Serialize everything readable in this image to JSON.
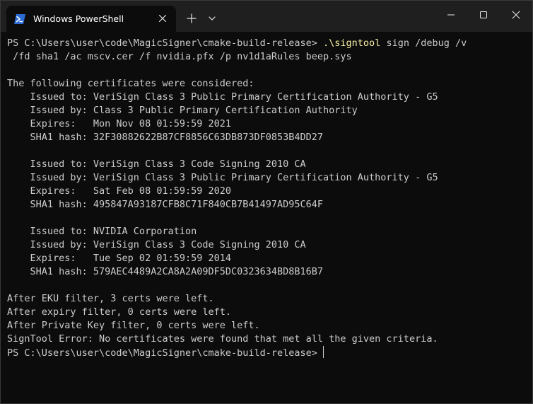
{
  "window": {
    "tab_title": "Windows PowerShell",
    "new_tab_symbol": "+"
  },
  "terminal": {
    "prompt": "PS C:\\Users\\user\\code\\MagicSigner\\cmake-build-release> ",
    "command": ".\\signtool",
    "command_args": " sign /debug /v",
    "command_continuation": " /fd sha1 /ac mscv.cer /f nvidia.pfx /p nv1d1aRules beep.sys",
    "lines": [
      "",
      "The following certificates were considered:",
      "    Issued to: VeriSign Class 3 Public Primary Certification Authority - G5",
      "    Issued by: Class 3 Public Primary Certification Authority",
      "    Expires:   Mon Nov 08 01:59:59 2021",
      "    SHA1 hash: 32F30882622B87CF8856C63DB873DF0853B4DD27",
      "",
      "    Issued to: VeriSign Class 3 Code Signing 2010 CA",
      "    Issued by: VeriSign Class 3 Public Primary Certification Authority - G5",
      "    Expires:   Sat Feb 08 01:59:59 2020",
      "    SHA1 hash: 495847A93187CFB8C71F840CB7B41497AD95C64F",
      "",
      "    Issued to: NVIDIA Corporation",
      "    Issued by: VeriSign Class 3 Code Signing 2010 CA",
      "    Expires:   Tue Sep 02 01:59:59 2014",
      "    SHA1 hash: 579AEC4489A2CA8A2A09DF5DC0323634BD8B16B7",
      "",
      "After EKU filter, 3 certs were left.",
      "After expiry filter, 0 certs were left.",
      "After Private Key filter, 0 certs were left.",
      "SignTool Error: No certificates were found that met all the given criteria."
    ],
    "final_prompt": "PS C:\\Users\\user\\code\\MagicSigner\\cmake-build-release>"
  },
  "colors": {
    "background": "#0c0c0c",
    "titlebar": "#1f1f1f",
    "text": "#cccccc",
    "command_highlight": "#f9f1a5",
    "powershell_icon": "#2c6bd6"
  }
}
